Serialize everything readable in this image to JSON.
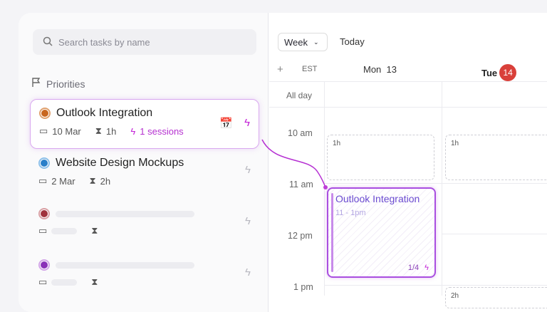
{
  "search": {
    "placeholder": "Search tasks by name"
  },
  "priorities_label": "Priorities",
  "tasks": [
    {
      "title": "Outlook Integration",
      "date": "10 Mar",
      "duration": "1h",
      "sessions": "1 sessions",
      "color": "#c8661f"
    },
    {
      "title": "Website Design Mockups",
      "date": "2 Mar",
      "duration": "2h",
      "color": "#2a7fc9"
    }
  ],
  "calendar": {
    "view": "Week",
    "today": "Today",
    "timezone": "EST",
    "days": [
      {
        "label": "Mon",
        "num": "13"
      },
      {
        "label": "Tue",
        "num": "14"
      }
    ],
    "all_day": "All day",
    "hours": [
      "10 am",
      "11 am",
      "12 pm",
      "1 pm"
    ],
    "slots": [
      "1h",
      "1h",
      "2h"
    ],
    "event": {
      "title": "Outlook Integration",
      "time": "11 - 1pm",
      "progress": "1/4"
    }
  }
}
